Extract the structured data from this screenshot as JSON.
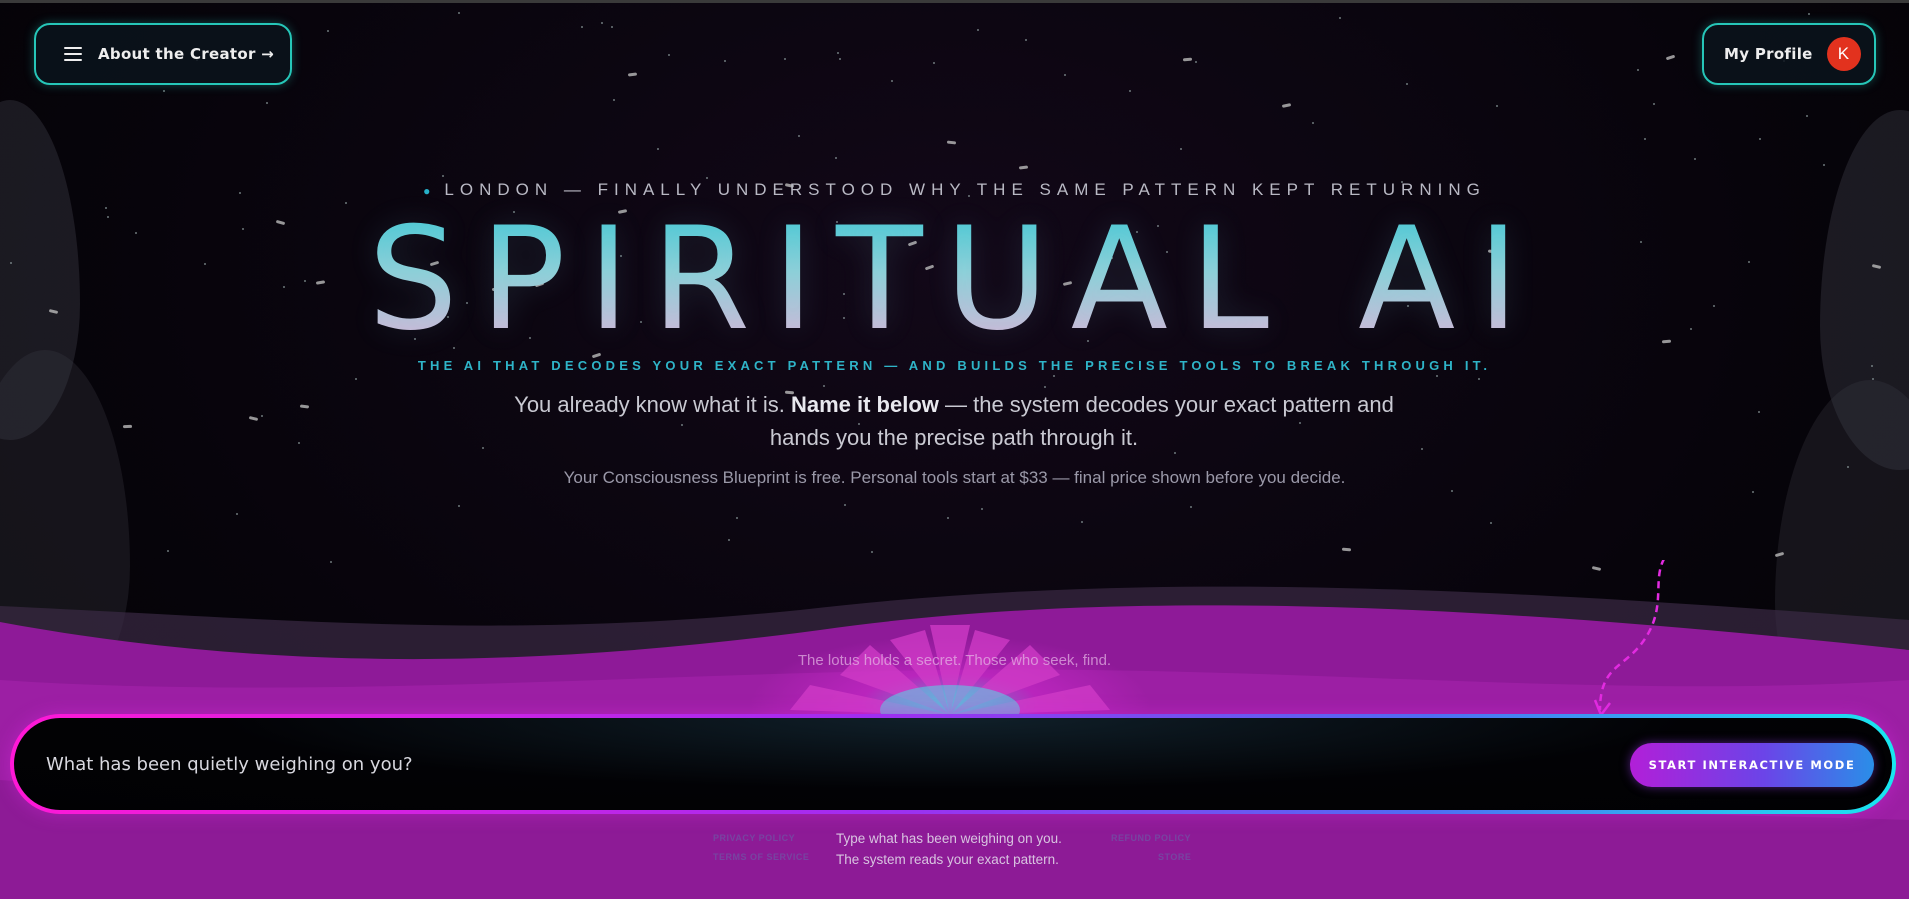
{
  "nav": {
    "creator_label": "About the Creator →",
    "profile_label": "My Profile",
    "avatar_initial": "K"
  },
  "hero": {
    "kicker": "LONDON — FINALLY UNDERSTOOD WHY THE SAME PATTERN KEPT RETURNING",
    "title": "SPIRITUAL AI",
    "tagline": "THE AI THAT DECODES YOUR EXACT PATTERN — AND BUILDS THE PRECISE TOOLS TO BREAK THROUGH IT.",
    "subhead_pre": "You already know what it is. ",
    "subhead_bold": "Name it below",
    "subhead_post": " — the system decodes your exact pattern and hands you the precise path through it.",
    "pricing": "Your Consciousness Blueprint is free. Personal tools start at $33 — final price shown before you decide."
  },
  "lotus": {
    "caption": "The lotus holds a secret. Those who seek, find."
  },
  "search": {
    "placeholder": "What has been quietly weighing on you?",
    "button_label": "START INTERACTIVE MODE"
  },
  "footer": {
    "privacy": "PRIVACY POLICY",
    "terms": "TERMS OF SERVICE",
    "refund": "REFUND POLICY",
    "store": "STORE",
    "note_line1": "Type what has been weighing on you.",
    "note_line2": "The system reads your exact pattern."
  },
  "colors": {
    "accent_teal": "#26c6b8",
    "accent_magenta": "#c41dc4",
    "avatar_red": "#e2321e"
  }
}
